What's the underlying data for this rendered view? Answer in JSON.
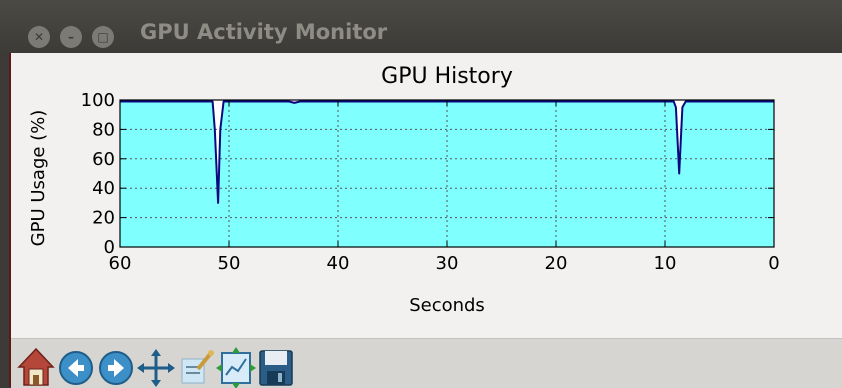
{
  "window": {
    "title": "GPU Activity Monitor",
    "buttons": [
      "close",
      "minimize",
      "maximize"
    ]
  },
  "chart_data": {
    "type": "area",
    "title": "GPU History",
    "xlabel": "Seconds",
    "ylabel": "GPU Usage (%)",
    "xlim": [
      60,
      0
    ],
    "ylim": [
      0,
      100
    ],
    "xticks": [
      "60",
      "50",
      "40",
      "30",
      "20",
      "10",
      "0"
    ],
    "yticks": [
      "0",
      "20",
      "40",
      "60",
      "80",
      "100"
    ],
    "grid": true,
    "fill_color": "#80ffff",
    "line_color": "#0a0a80",
    "series": [
      {
        "x": [
          60,
          51.5,
          51.3,
          51.0,
          50.8,
          50.5,
          44.5,
          44.0,
          43.5,
          9.2,
          9.0,
          8.7,
          8.4,
          8.1,
          0
        ],
        "values": [
          99,
          99,
          80,
          30,
          80,
          99,
          99,
          98,
          99,
          99,
          95,
          50,
          95,
          99,
          99
        ]
      }
    ]
  },
  "toolbar": {
    "items": [
      "home-icon",
      "back-icon",
      "forward-icon",
      "pan-icon",
      "zoom-icon",
      "configure-subplots-icon",
      "save-icon"
    ]
  }
}
